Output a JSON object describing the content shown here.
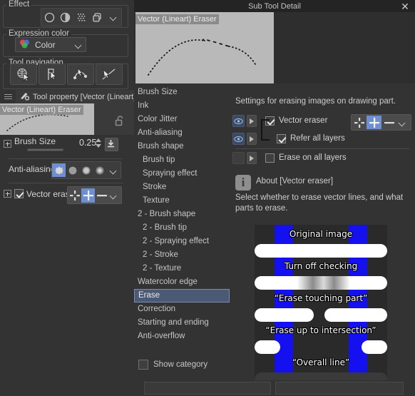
{
  "left_panel": {
    "groups": {
      "effect": {
        "title": "Effect",
        "icons": [
          {
            "name": "circle-outline-icon",
            "selected": false
          },
          {
            "name": "half-shaded-circle-icon",
            "selected": false
          },
          {
            "name": "halftone-dots-icon",
            "selected": false
          },
          {
            "name": "layered-squares-icon",
            "selected": false
          },
          {
            "name": "chevron-down-icon",
            "selected": false
          }
        ]
      },
      "expression_color": {
        "title": "Expression color",
        "value": "Color",
        "icon": "color-circles-icon"
      },
      "tool_navigation": {
        "title": "Tool navigation",
        "buttons": [
          {
            "name": "object-select-icon"
          },
          {
            "name": "control-point-icon"
          },
          {
            "name": "vector-path-icon"
          },
          {
            "name": "line-correction-icon"
          }
        ]
      }
    },
    "tool_property": {
      "menu_icon": "hamburger-menu-icon",
      "tool_icon": "tool-property-icon",
      "title": "Tool property [Vector (Lineart)",
      "preview_name": "Vector (Lineart) Eraser",
      "lock_icon": "unlocked-padlock-icon"
    },
    "brush_size": {
      "label": "Brush Size",
      "value": "0.25",
      "slider_percent": 30,
      "expand_icon": "plus-box-icon",
      "spinner_icon": "spinner-updown-icon",
      "download_icon": "import-value-icon"
    },
    "anti_aliasing": {
      "label": "Anti-aliasing",
      "options": [
        "none",
        "weak",
        "medium",
        "strong"
      ],
      "selected_index": 0,
      "chevron": "chevron-down-icon"
    },
    "vector_eraser": {
      "label": "Vector eraser",
      "checked": true,
      "expand_icon": "plus-box-icon",
      "modes": [
        "erase-touching-part",
        "erase-up-to-intersection",
        "overall-line"
      ],
      "selected_index": 1,
      "chevron": "chevron-down-icon"
    }
  },
  "window": {
    "title": "Sub Tool Detail",
    "close_icon": "close-icon",
    "preview_label": "Vector (Lineart) Eraser"
  },
  "categories": {
    "items": [
      {
        "label": "Brush Size",
        "indent": false,
        "selected": false
      },
      {
        "label": "Ink",
        "indent": false,
        "selected": false
      },
      {
        "label": "Color Jitter",
        "indent": false,
        "selected": false
      },
      {
        "label": "Anti-aliasing",
        "indent": false,
        "selected": false
      },
      {
        "label": "Brush shape",
        "indent": false,
        "selected": false
      },
      {
        "label": "Brush tip",
        "indent": true,
        "selected": false
      },
      {
        "label": "Spraying effect",
        "indent": true,
        "selected": false
      },
      {
        "label": "Stroke",
        "indent": true,
        "selected": false
      },
      {
        "label": "Texture",
        "indent": true,
        "selected": false
      },
      {
        "label": "2 - Brush shape",
        "indent": false,
        "selected": false
      },
      {
        "label": "2 - Brush tip",
        "indent": true,
        "selected": false
      },
      {
        "label": "2 - Spraying effect",
        "indent": true,
        "selected": false
      },
      {
        "label": "2 - Stroke",
        "indent": true,
        "selected": false
      },
      {
        "label": "2 - Texture",
        "indent": true,
        "selected": false
      },
      {
        "label": "Watercolor edge",
        "indent": false,
        "selected": false
      },
      {
        "label": "Erase",
        "indent": false,
        "selected": true
      },
      {
        "label": "Correction",
        "indent": false,
        "selected": false
      },
      {
        "label": "Starting and ending",
        "indent": false,
        "selected": false
      },
      {
        "label": "Anti-overflow",
        "indent": false,
        "selected": false
      }
    ],
    "show_category": {
      "label": "Show category",
      "checked": false
    }
  },
  "settings": {
    "description": "Settings for erasing images on drawing part.",
    "options": [
      {
        "label": "Vector eraser",
        "checked": true,
        "eye_active": true,
        "eye_icon": "eye-icon",
        "expand_icon": "triangle-right-icon"
      },
      {
        "label": "Refer all layers",
        "checked": true,
        "eye_active": true,
        "eye_icon": "eye-icon",
        "expand_icon": "triangle-right-icon"
      },
      {
        "label": "Erase on all layers",
        "checked": false,
        "eye_active": false,
        "eye_icon": "eye-icon",
        "expand_icon": "triangle-right-icon"
      }
    ],
    "mode_buttons": {
      "modes": [
        "erase-touching-part",
        "erase-up-to-intersection",
        "overall-line"
      ],
      "selected_index": 1,
      "chevron": "chevron-down-icon"
    },
    "about": {
      "icon": "info-icon",
      "title": "About [Vector eraser]",
      "body": "Select whether to erase vector lines, and what parts to erase."
    },
    "illustration": {
      "captions": [
        "Original image",
        "Turn off checking",
        "“Erase touching part”",
        "“Erase up to intersection”",
        "“Overall line”"
      ],
      "line_color": "#ffffff",
      "bar_color": "#1410f0",
      "bg_color": "#2a2a2a"
    }
  },
  "colors": {
    "window_bg": "#333333",
    "titlebar_bg": "#242424",
    "accent_blue": "#6e8fd0",
    "selection_blue": "#4b5a74",
    "canvas_gray": "#b9b9b9"
  }
}
